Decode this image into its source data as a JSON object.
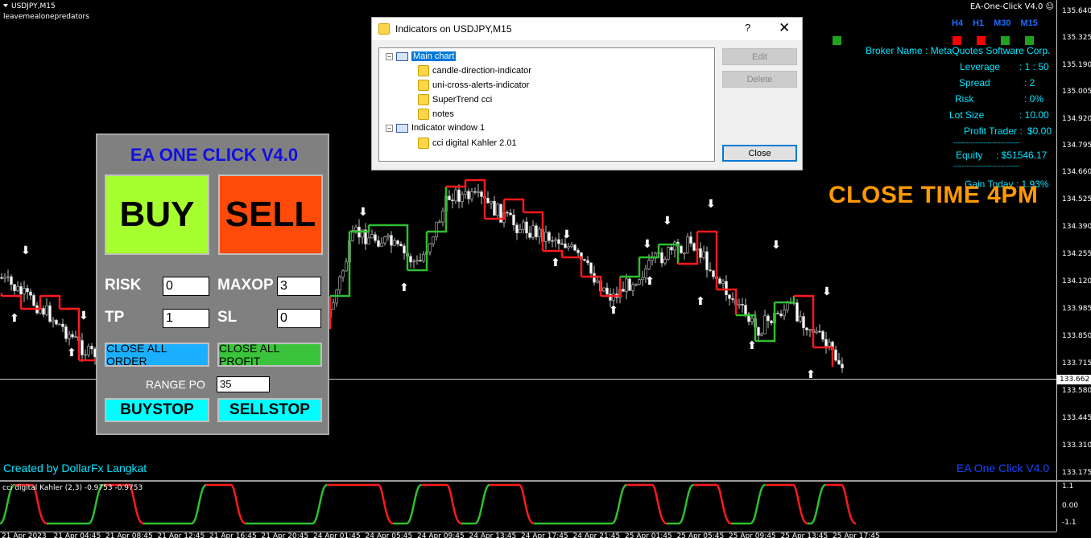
{
  "chart": {
    "symbol_title": "USDJPY,M15",
    "subtitle": "leavemealonepredators",
    "ea_name_top": "EA-One-Click V4.0 ☺",
    "current_price": "133.662",
    "price_labels": [
      "135.640",
      "135.325",
      "135.190",
      "135.005",
      "134.920",
      "134.795",
      "134.660",
      "134.525",
      "134.390",
      "134.255",
      "134.120",
      "133.985",
      "133.850",
      "133.715",
      "133.580",
      "133.445",
      "133.310",
      "133.175"
    ],
    "time_labels": [
      "21 Apr 2023",
      "21 Apr 04:45",
      "21 Apr 08:45",
      "21 Apr 12:45",
      "21 Apr 16:45",
      "21 Apr 20:45",
      "24 Apr 01:45",
      "24 Apr 05:45",
      "24 Apr 09:45",
      "24 Apr 13:45",
      "24 Apr 17:45",
      "24 Apr 21:45",
      "25 Apr 01:45",
      "25 Apr 05:45",
      "25 Apr 09:45",
      "25 Apr 13:45",
      "25 Apr 17:45"
    ],
    "sub_title": "cci digital Kahler (2,3) -0.9753 -0.9753",
    "sub_axis_labels": [
      "1.1",
      "0.00",
      "-1.1"
    ],
    "line_colors": {
      "up": "#2fbf2f",
      "down": "#ff1a1a"
    }
  },
  "timeframes": {
    "labels": [
      "H4",
      "H1",
      "M30",
      "M15"
    ],
    "colors": [
      "#ff0000",
      "#ff0000",
      "#1fa31f",
      "#1fa31f"
    ]
  },
  "info": {
    "broker": "Broker Name : MetaQuotes Software Corp.",
    "leverage_label": "Leverage",
    "leverage_value": ": 1 : 50",
    "spread_label": "Spread",
    "spread_value": ":   2",
    "risk_label": "Risk",
    "risk_value": ":   0%",
    "lot_label": "Lot Size",
    "lot_value": ": 10.00",
    "profit_label": "Profit Trader :",
    "profit_value": "$0.00",
    "sep1": "-------------------------------",
    "equity_label": "Equity",
    "equity_value": ": $51546.17",
    "sep2": "-------------------------------",
    "gain": "Gain Today : 1.93%"
  },
  "overlay": {
    "close_time": "CLOSE TIME 4PM",
    "created_by": "Created by DollarFx Langkat",
    "ea_bottom": "EA One Click V4.0"
  },
  "ea_panel": {
    "title": "EA ONE CLICK V4.0",
    "buy": "BUY",
    "sell": "SELL",
    "risk_label": "RISK",
    "risk_value": "0",
    "maxop_label": "MAXOP",
    "maxop_value": "3",
    "tp_label": "TP",
    "tp_value": "1",
    "sl_label": "SL",
    "sl_value": "0",
    "close_all_order": "CLOSE ALL ORDER",
    "close_all_profit": "CLOSE ALL PROFIT",
    "range_label": "RANGE PO",
    "range_value": "35",
    "buystop": "BUYSTOP",
    "sellstop": "SELLSTOP"
  },
  "dialog": {
    "title": "Indicators on USDJPY,M15",
    "help": "?",
    "close_x": "✕",
    "tree": {
      "main_chart": "Main chart",
      "main_items": [
        "candle-direction-indicator",
        "uni-cross-alerts-indicator",
        "SuperTrend cci",
        "notes"
      ],
      "window": "Indicator window 1",
      "window_items": [
        "cci digital Kahler 2.01"
      ]
    },
    "edit": "Edit",
    "delete": "Delete",
    "close": "Close"
  }
}
